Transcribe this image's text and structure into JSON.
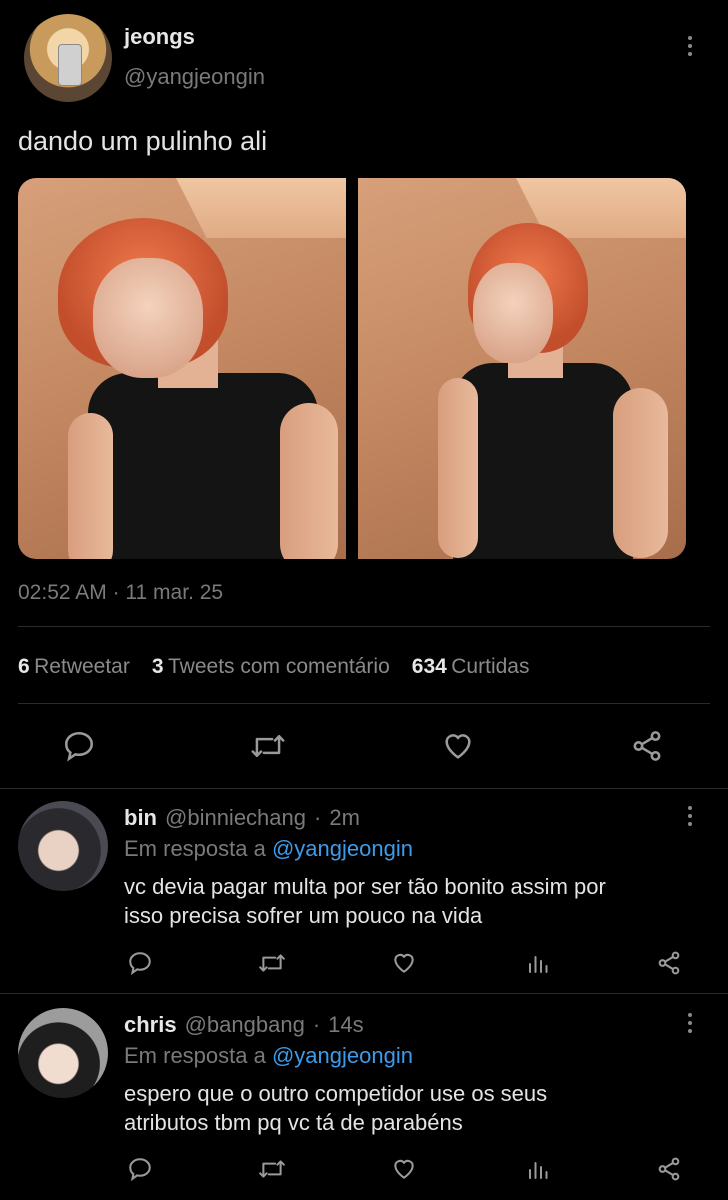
{
  "tweet": {
    "author_name": "jeongs",
    "author_handle": "@yangjeongin",
    "text": "dando um pulinho ali",
    "time": "02:52 AM",
    "date": "11 mar. 25",
    "stats": {
      "retweets_count": "6",
      "retweets_label": "Retweetar",
      "quotes_count": "3",
      "quotes_label": "Tweets com comentário",
      "likes_count": "634",
      "likes_label": "Curtidas"
    }
  },
  "replies": [
    {
      "name": "bin",
      "handle": "@binniechang",
      "time": "2m",
      "reply_prefix": "Em resposta a",
      "reply_mention": "@yangjeongin",
      "text_line1": "vc devia pagar multa por ser tão bonito assim por",
      "text_line2": "isso precisa sofrer um pouco na vida"
    },
    {
      "name": "chris",
      "handle": "@bangbang",
      "time": "14s",
      "reply_prefix": "Em resposta a",
      "reply_mention": "@yangjeongin",
      "text_line1": "espero que o outro competidor use os seus",
      "text_line2": "atributos tbm pq vc tá de parabéns"
    }
  ],
  "separators": {
    "dot": "·"
  },
  "colors": {
    "background": "#000000",
    "link": "#3d9be9",
    "muted": "#7a7a7a"
  }
}
